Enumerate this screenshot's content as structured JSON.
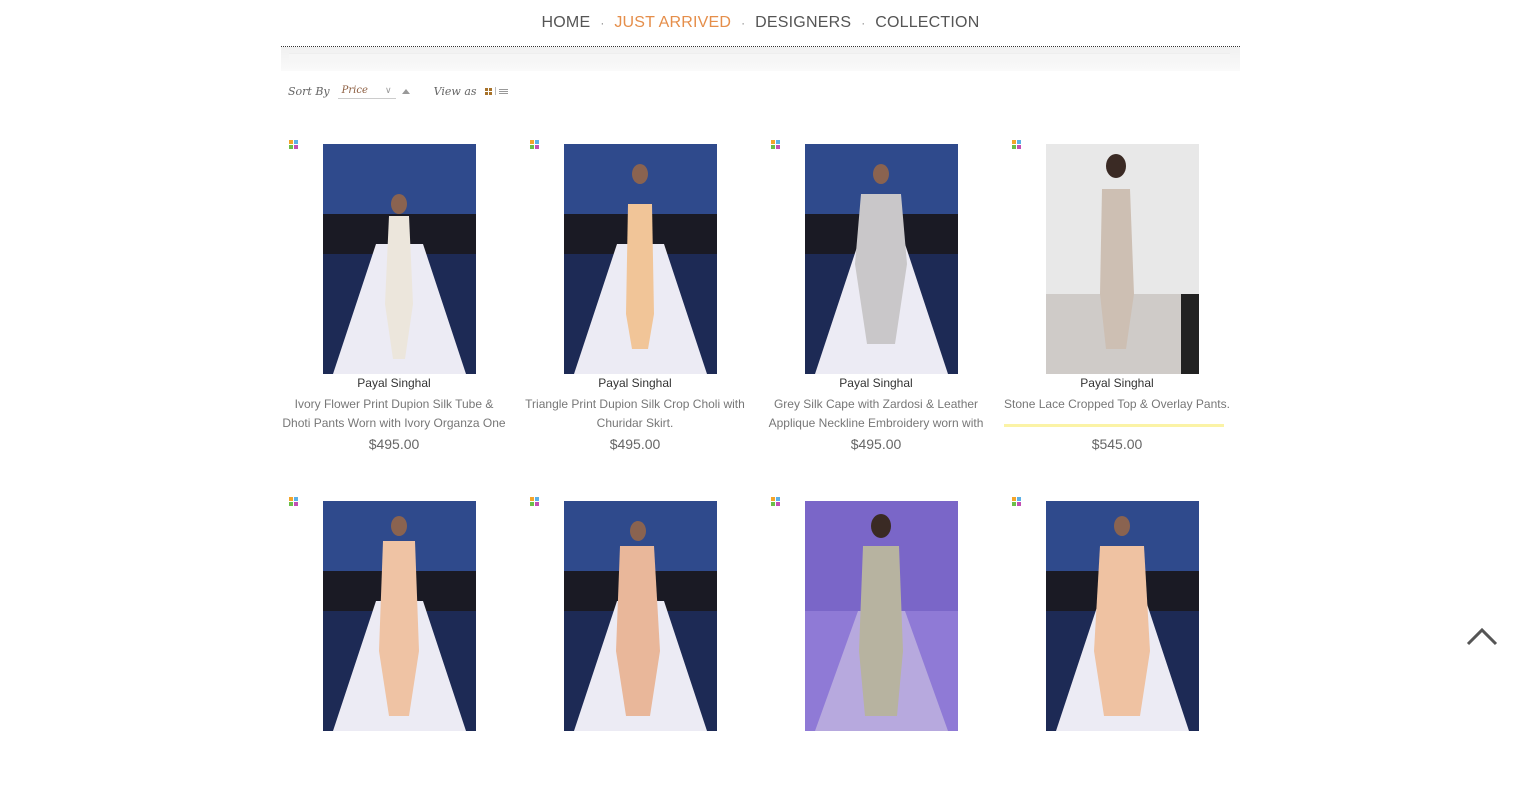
{
  "nav": {
    "items": [
      {
        "label": "HOME",
        "active": false
      },
      {
        "label": "JUST ARRIVED",
        "active": true
      },
      {
        "label": "DESIGNERS",
        "active": false
      },
      {
        "label": "COLLECTION",
        "active": false
      }
    ],
    "separator": "·"
  },
  "toolbar": {
    "sort_label": "Sort By",
    "sort_value": "Price",
    "view_label": "View as"
  },
  "colors": {
    "accent": "#e58e4a",
    "highlight": "#fbf3a6"
  },
  "products": [
    {
      "designer": "Payal Singhal",
      "name": "Ivory Flower Print Dupion Silk Tube & Dhoti Pants Worn with Ivory Organza One",
      "price": "$495.00",
      "highlighted": false
    },
    {
      "designer": "Payal Singhal",
      "name": "Triangle Print Dupion Silk Crop Choli with Churidar Skirt.",
      "price": "$495.00",
      "highlighted": false
    },
    {
      "designer": "Payal Singhal",
      "name": "Grey Silk Cape with Zardosi & Leather Applique Neckline Embroidery worn with",
      "price": "$495.00",
      "highlighted": false
    },
    {
      "designer": "Payal Singhal",
      "name": "Stone Lace Cropped Top & Overlay Pants.",
      "price": "$545.00",
      "highlighted": true
    },
    {
      "designer": "",
      "name": "",
      "price": "",
      "highlighted": false
    },
    {
      "designer": "",
      "name": "",
      "price": "",
      "highlighted": false
    },
    {
      "designer": "",
      "name": "",
      "price": "",
      "highlighted": false
    },
    {
      "designer": "",
      "name": "",
      "price": "",
      "highlighted": false
    }
  ]
}
